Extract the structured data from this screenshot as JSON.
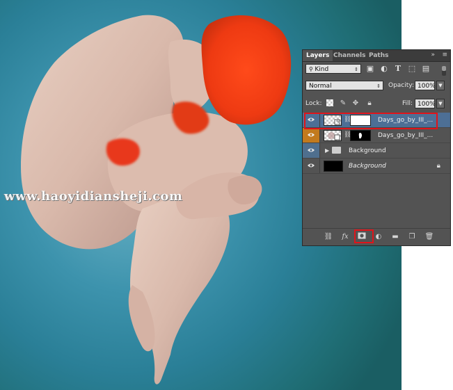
{
  "watermark": "www.haoyidiansheji.com",
  "panel": {
    "tabs": [
      "Layers",
      "Channels",
      "Paths"
    ],
    "collapse_glyph": "»",
    "menu_glyph": "≡",
    "filter": {
      "label": "Kind",
      "icons": [
        "image-filter-icon",
        "adjustment-filter-icon",
        "type-filter-icon",
        "shape-filter-icon",
        "smart-object-filter-icon"
      ]
    },
    "blend_mode": "Normal",
    "opacity_label": "Opacity:",
    "opacity_value": "100%",
    "lock_label": "Lock:",
    "fill_label": "Fill:",
    "fill_value": "100%",
    "layers": [
      {
        "name": "Days_go_by_III_...",
        "selected": true,
        "visible": true,
        "has_mask": true,
        "mask_color": "white",
        "italic": false
      },
      {
        "name": "Days_go_by_III_...",
        "selected": false,
        "visible": true,
        "has_mask": true,
        "mask_color": "black",
        "italic": false
      },
      {
        "name": "Background",
        "type": "group",
        "visible": true,
        "italic": false
      },
      {
        "name": "Background",
        "type": "background",
        "visible": true,
        "locked": true,
        "italic": true
      }
    ],
    "bottom_icons": [
      "link-layers-icon",
      "fx-icon",
      "add-mask-icon",
      "adjustment-layer-icon",
      "new-group-icon",
      "new-layer-icon",
      "delete-layer-icon"
    ],
    "fx_label": "fx"
  },
  "colors": {
    "highlight": "#e0141a",
    "panel_bg": "#535353",
    "selected_row": "#4d6f95",
    "eye_cell_orange": "#c27a1d",
    "eye_cell_blue": "#4f6f8e"
  }
}
